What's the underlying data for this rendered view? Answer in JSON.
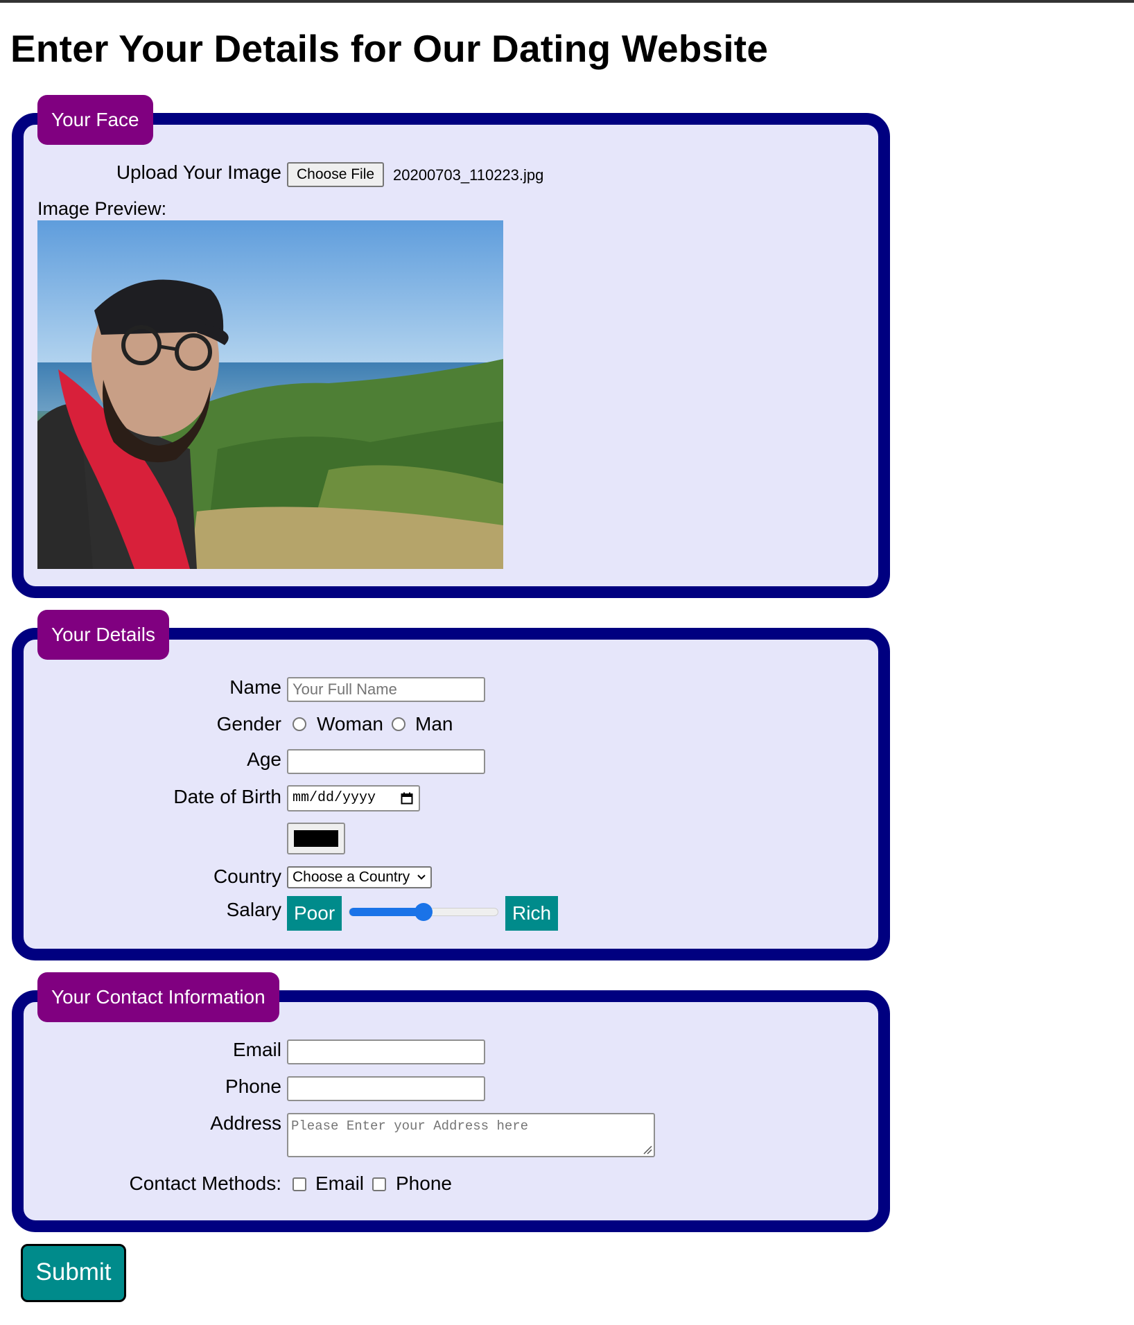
{
  "page": {
    "title": "Enter Your Details for Our Dating Website"
  },
  "face_section": {
    "legend": "Your Face",
    "upload_label": "Upload Your Image",
    "choose_file_label": "Choose File",
    "file_name": "20200703_110223.jpg",
    "preview_label": "Image Preview:"
  },
  "details_section": {
    "legend": "Your Details",
    "name_label": "Name",
    "name_placeholder": "Your Full Name",
    "gender_label": "Gender",
    "gender_options": [
      "Woman",
      "Man"
    ],
    "age_label": "Age",
    "dob_label": "Date of Birth",
    "dob_placeholder": "mm/dd/yyyy",
    "color_value": "#000000",
    "country_label": "Country",
    "country_selected": "Choose a Country",
    "salary_label": "Salary",
    "salary_min_label": "Poor",
    "salary_max_label": "Rich",
    "salary_level": 0.5
  },
  "contact_section": {
    "legend": "Your Contact Information",
    "email_label": "Email",
    "phone_label": "Phone",
    "address_label": "Address",
    "address_placeholder": "Please Enter your Address here",
    "contact_methods_label": "Contact Methods:",
    "contact_options": [
      "Email",
      "Phone"
    ]
  },
  "submit_label": "Submit",
  "colors": {
    "fieldset_bg": "#e6e6fa",
    "fieldset_border": "#000080",
    "legend_bg": "#800080",
    "accent_teal": "#008b8b",
    "slider_blue": "#1a73e8"
  }
}
